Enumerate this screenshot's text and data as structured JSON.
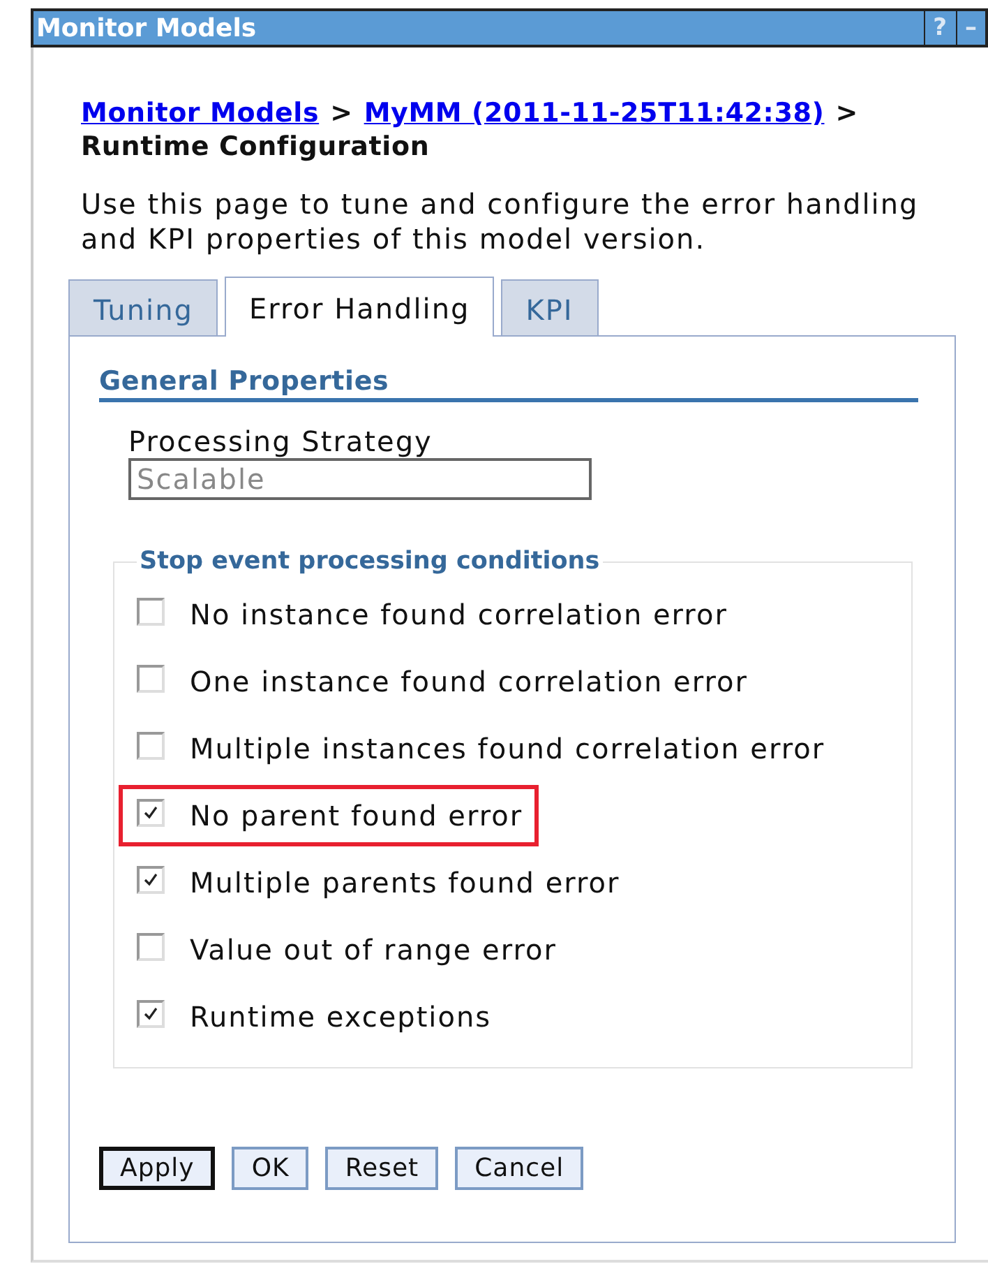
{
  "window": {
    "title": "Monitor Models",
    "help": "?",
    "minimize": "–"
  },
  "breadcrumb": {
    "links": [
      "Monitor Models",
      "MyMM (2011-11-25T11:42:38)"
    ],
    "separator": ">",
    "current": "Runtime Configuration"
  },
  "description": "Use this page to tune and configure the error handling and KPI properties of this model version.",
  "tabs": [
    {
      "label": "Tuning",
      "selected": false
    },
    {
      "label": "Error Handling",
      "selected": true
    },
    {
      "label": "KPI",
      "selected": false
    }
  ],
  "section": {
    "title": "General Properties"
  },
  "processing_strategy": {
    "label": "Processing Strategy",
    "value": "Scalable",
    "disabled": true
  },
  "conditions": {
    "legend": "Stop event processing conditions",
    "items": [
      {
        "label": "No instance found correlation error",
        "checked": false,
        "highlighted": false
      },
      {
        "label": "One instance found correlation error",
        "checked": false,
        "highlighted": false
      },
      {
        "label": "Multiple instances found correlation error",
        "checked": false,
        "highlighted": false
      },
      {
        "label": "No parent found error",
        "checked": true,
        "highlighted": true
      },
      {
        "label": "Multiple parents found error",
        "checked": true,
        "highlighted": false
      },
      {
        "label": "Value out of range error",
        "checked": false,
        "highlighted": false
      },
      {
        "label": "Runtime exceptions",
        "checked": true,
        "highlighted": false
      }
    ]
  },
  "buttons": [
    {
      "label": "Apply",
      "default": true
    },
    {
      "label": "OK",
      "default": false
    },
    {
      "label": "Reset",
      "default": false
    },
    {
      "label": "Cancel",
      "default": false
    }
  ]
}
